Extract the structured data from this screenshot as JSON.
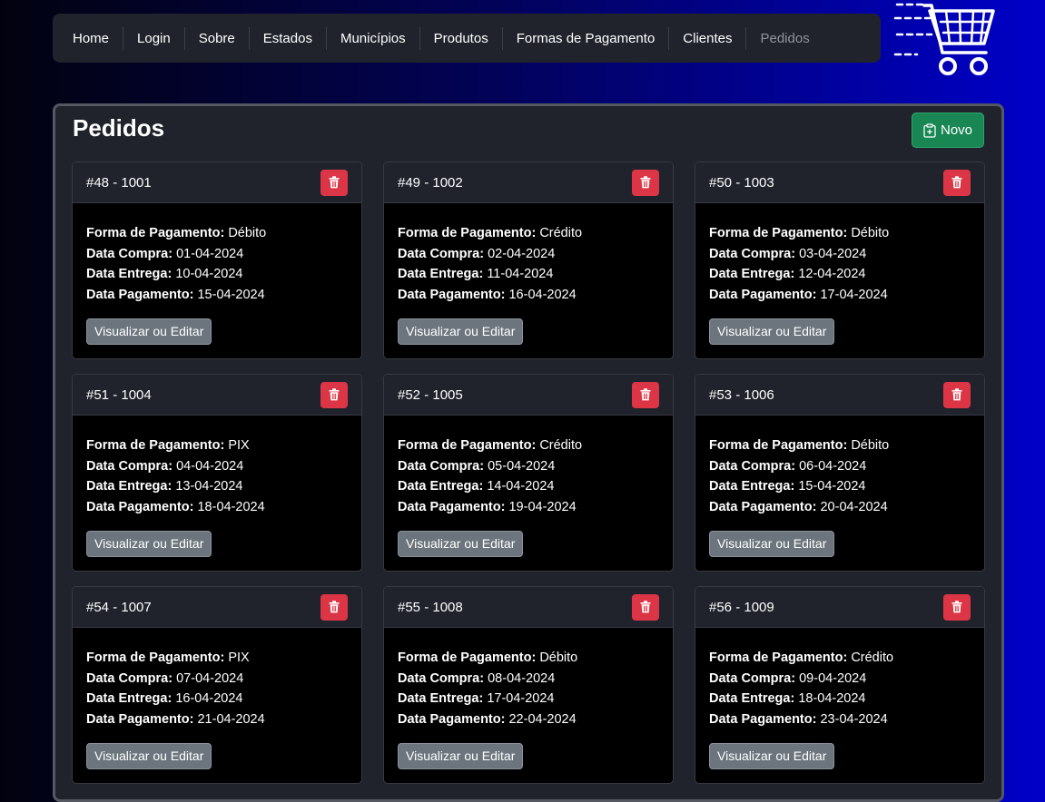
{
  "nav": {
    "items": [
      "Home",
      "Login",
      "Sobre",
      "Estados",
      "Municípios",
      "Produtos",
      "Formas de Pagamento",
      "Clientes",
      "Pedidos"
    ]
  },
  "page": {
    "title": "Pedidos",
    "new_label": "Novo"
  },
  "labels": {
    "forma": "Forma de Pagamento:",
    "compra": "Data Compra:",
    "entrega": "Data Entrega:",
    "pagamento": "Data Pagamento:",
    "edit": "Visualizar ou Editar"
  },
  "orders": [
    {
      "title": "#48 - 1001",
      "forma": "Débito",
      "compra": "01-04-2024",
      "entrega": "10-04-2024",
      "pagamento": "15-04-2024"
    },
    {
      "title": "#49 - 1002",
      "forma": "Crédito",
      "compra": "02-04-2024",
      "entrega": "11-04-2024",
      "pagamento": "16-04-2024"
    },
    {
      "title": "#50 - 1003",
      "forma": "Débito",
      "compra": "03-04-2024",
      "entrega": "12-04-2024",
      "pagamento": "17-04-2024"
    },
    {
      "title": "#51 - 1004",
      "forma": "PIX",
      "compra": "04-04-2024",
      "entrega": "13-04-2024",
      "pagamento": "18-04-2024"
    },
    {
      "title": "#52 - 1005",
      "forma": "Crédito",
      "compra": "05-04-2024",
      "entrega": "14-04-2024",
      "pagamento": "19-04-2024"
    },
    {
      "title": "#53 - 1006",
      "forma": "Débito",
      "compra": "06-04-2024",
      "entrega": "15-04-2024",
      "pagamento": "20-04-2024"
    },
    {
      "title": "#54 - 1007",
      "forma": "PIX",
      "compra": "07-04-2024",
      "entrega": "16-04-2024",
      "pagamento": "21-04-2024"
    },
    {
      "title": "#55 - 1008",
      "forma": "Débito",
      "compra": "08-04-2024",
      "entrega": "17-04-2024",
      "pagamento": "22-04-2024"
    },
    {
      "title": "#56 - 1009",
      "forma": "Crédito",
      "compra": "09-04-2024",
      "entrega": "18-04-2024",
      "pagamento": "23-04-2024"
    }
  ]
}
